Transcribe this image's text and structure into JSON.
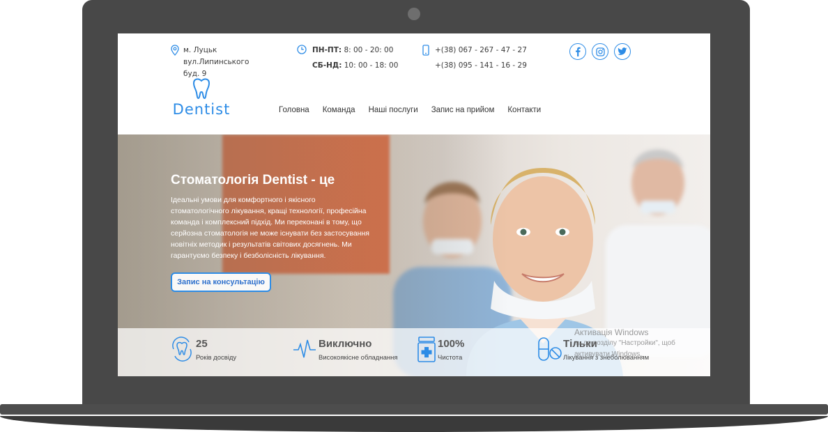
{
  "contacts": {
    "address_line1": "м. Луцьк вул.Липинського",
    "address_line2": "буд. 9",
    "hours_weekday_label": "ПН-ПТ:",
    "hours_weekday": "8: 00 - 20: 00",
    "hours_weekend_label": "СБ-НД:",
    "hours_weekend": "10: 00 - 18: 00",
    "phone1": "+(38) 067 - 267 - 47 - 27",
    "phone2": "+(38) 095 - 141 - 16 - 29"
  },
  "socials": [
    "facebook-icon",
    "instagram-icon",
    "twitter-icon"
  ],
  "logo": {
    "text": "Dentist",
    "icon": "tooth-icon"
  },
  "nav": [
    "Головна",
    "Команда",
    "Наші послуги",
    "Запис на прийом",
    "Контакти"
  ],
  "hero": {
    "title": "Стоматологія Dentist - це",
    "text": "Ідеальні умови для комфортного і якісного стоматологічного лікування, кращі технології, професійна команда і комплексний підхід. Ми переконані в тому, що серйозна стоматологія не може існувати без застосування новітніх методик і результатів світових досягнень. Ми гарантуємо безпеку і безболісність лікування.",
    "button": "Запис на консультацію"
  },
  "stats": [
    {
      "value": "25",
      "label": "Років досвіду",
      "icon": "tooth-cycle-icon"
    },
    {
      "value": "Виключно",
      "label": "Високоякісне обладнання",
      "icon": "pulse-icon"
    },
    {
      "value": "100%",
      "label": "Чистота",
      "icon": "medicine-jar-icon"
    },
    {
      "value": "Тільки",
      "label": "Лікування з знеболюванням",
      "icon": "pills-icon"
    }
  ],
  "watermark": {
    "line1": "Активація Windows",
    "line2": "ть до розділу \"Настройки\", щоб",
    "line3": "активувати Windows."
  },
  "colors": {
    "accent": "#2d8ce6",
    "hero_orange": "#e9673a",
    "frame": "#484848"
  }
}
